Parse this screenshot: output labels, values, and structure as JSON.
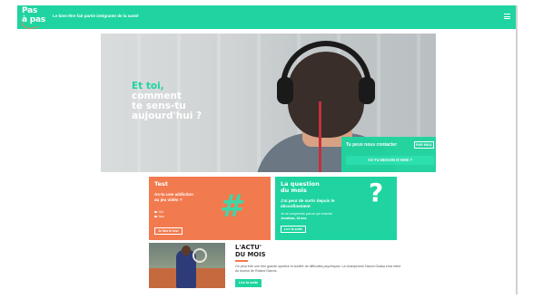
{
  "header": {
    "logo_line1": "Pas",
    "logo_line2": "à pas",
    "tagline": "Le bien-être fait partie intégrante de la santé"
  },
  "hero": {
    "greeting": "Et toi,",
    "line2": "comment",
    "line3": "te sens-tu",
    "line4": "aujourd'hui ?",
    "contact_label": "Tu peux nous contacter",
    "mail_button": "PAR MAIL",
    "help_button": "AS-TU BESOIN D'AIDE ?"
  },
  "cards": {
    "test": {
      "title": "Test",
      "question_line1": "As-tu une addiction",
      "question_line2": "au jeu vidéo ?",
      "options": [
        "Oui",
        "Non"
      ],
      "button": "Je fais le test",
      "icon": "hashtag-icon"
    },
    "question": {
      "title_line1": "La question",
      "title_line2": "du mois",
      "question_line1": "J'ai peur de sortir depuis le",
      "question_line2": "déconfinement",
      "body": "Je ne comprends pas ce qui m'arrive",
      "meta": "Jonathan, 16 ans",
      "button": "Lire la suite",
      "icon": "question-mark-icon"
    }
  },
  "news": {
    "title_line1": "L'ACTU'",
    "title_line2": "DU MOIS",
    "body": "On peut être une très grande sportive et souffrir de difficultés psychiques. La championne Naomi Osaka s'est retiré du tournoi de Roland Garros.",
    "button": "Lire la suite"
  },
  "colors": {
    "brand_green": "#1fd4a0",
    "brand_orange": "#f27a4f"
  }
}
